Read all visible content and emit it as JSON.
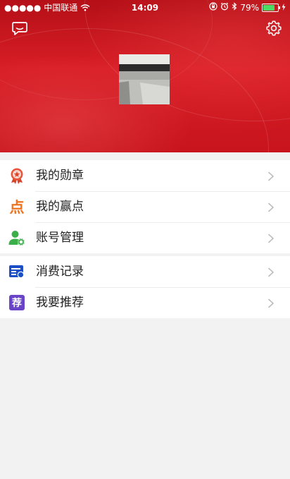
{
  "status_bar": {
    "signal": "●●●●●",
    "carrier": "中国联通",
    "time": "14:09",
    "battery": "79%",
    "battery_level": 0.79
  },
  "header": {
    "chat_icon": "chat-bubble-icon",
    "settings_icon": "gear-icon"
  },
  "menu": {
    "group1": [
      {
        "label": "我的勋章",
        "icon": "medal-icon",
        "color": "#e0442a"
      },
      {
        "label": "我的赢点",
        "icon": "dian-glyph-icon",
        "glyph": "点",
        "color": "#f07320"
      },
      {
        "label": "账号管理",
        "icon": "user-gear-icon",
        "color": "#3bb04a"
      }
    ],
    "group2": [
      {
        "label": "消费记录",
        "icon": "record-card-icon",
        "color": "#1c4fc6"
      },
      {
        "label": "我要推荐",
        "icon": "recommend-tile-icon",
        "glyph": "荐",
        "color": "#6a44c7"
      }
    ]
  },
  "colors": {
    "header_red": "#d81e26",
    "background": "#f2f2f2",
    "chevron": "#bdbdbd"
  }
}
